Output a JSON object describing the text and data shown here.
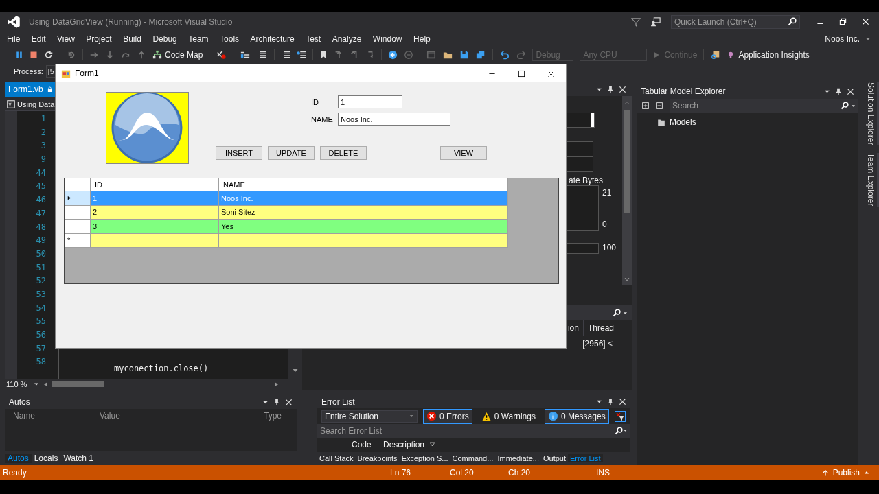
{
  "window": {
    "title": "Using DataGridView (Running) - Microsoft Visual Studio"
  },
  "quick_launch": {
    "placeholder": "Quick Launch (Ctrl+Q)"
  },
  "menu": [
    "File",
    "Edit",
    "View",
    "Project",
    "Build",
    "Debug",
    "Team",
    "Tools",
    "Architecture",
    "Test",
    "Analyze",
    "Window",
    "Help"
  ],
  "account": "Noos Inc.",
  "toolbar": {
    "code_map": "Code Map",
    "configuration": "Debug",
    "platform": "Any CPU",
    "continue": "Continue",
    "insights": "Application Insights"
  },
  "process": {
    "label": "Process:",
    "value": "[5"
  },
  "editor": {
    "tab": "Form1.vb",
    "nav": "Using Data",
    "line_numbers": [
      "1",
      "2",
      "3",
      "9",
      "44",
      "45",
      "46",
      "47",
      "48",
      "49",
      "50",
      "51",
      "52",
      "53",
      "54",
      "55",
      "56",
      "57",
      "58"
    ],
    "code_line": "myconection.close()",
    "zoom": "110 %"
  },
  "diagnostics": {
    "graph_label": "ate Bytes",
    "ticks": [
      "21",
      "0",
      "100"
    ],
    "columns": [
      "ion",
      "Thread"
    ],
    "row": "[2956] <"
  },
  "form": {
    "title": "Form1",
    "fields": [
      {
        "label": "ID",
        "value": "1"
      },
      {
        "label": "NAME",
        "value": "Noos Inc."
      }
    ],
    "buttons": [
      "INSERT",
      "UPDATE",
      "DELETE",
      "VIEW"
    ],
    "grid": {
      "columns": [
        "ID",
        "NAME"
      ],
      "rows": [
        {
          "kind": "data",
          "id": "1",
          "name": "Noos Inc.",
          "selected": true
        },
        {
          "kind": "data",
          "id": "2",
          "name": "Soni Sitez",
          "selected": false,
          "color": "#ffff80"
        },
        {
          "kind": "data",
          "id": "3",
          "name": "Yes",
          "selected": false,
          "color": "#80ff80"
        },
        {
          "kind": "new",
          "marker": "*",
          "selected": false,
          "color": "#ffff80"
        }
      ]
    }
  },
  "tabular_explorer": {
    "title": "Tabular Model Explorer",
    "search": {
      "placeholder": "Search"
    },
    "tree": [
      {
        "label": "Models"
      }
    ]
  },
  "side_tabs": [
    "Solution Explorer",
    "Team Explorer"
  ],
  "autos": {
    "title": "Autos",
    "columns": [
      "Name",
      "Value",
      "Type"
    ],
    "tabs": [
      {
        "label": "Autos",
        "selected": true
      },
      {
        "label": "Locals",
        "selected": false
      },
      {
        "label": "Watch 1",
        "selected": false
      }
    ]
  },
  "error_list": {
    "title": "Error List",
    "scope": "Entire Solution",
    "filters": [
      {
        "kind": "error",
        "label": "0 Errors",
        "selected": true
      },
      {
        "kind": "warning",
        "label": "0 Warnings",
        "selected": false
      },
      {
        "kind": "message",
        "label": "0 Messages",
        "selected": true
      }
    ],
    "search": {
      "placeholder": "Search Error List"
    },
    "columns": [
      "Code",
      "Description"
    ],
    "tabs": [
      {
        "label": "Call Stack",
        "selected": false
      },
      {
        "label": "Breakpoints",
        "selected": false
      },
      {
        "label": "Exception S...",
        "selected": false
      },
      {
        "label": "Command...",
        "selected": false
      },
      {
        "label": "Immediate...",
        "selected": false
      },
      {
        "label": "Output",
        "selected": false
      },
      {
        "label": "Error List",
        "selected": true
      }
    ]
  },
  "status_bar": {
    "state": "Ready",
    "line": "Ln 76",
    "column": "Col 20",
    "char": "Ch 20",
    "mode": "INS",
    "publish": "Publish"
  }
}
